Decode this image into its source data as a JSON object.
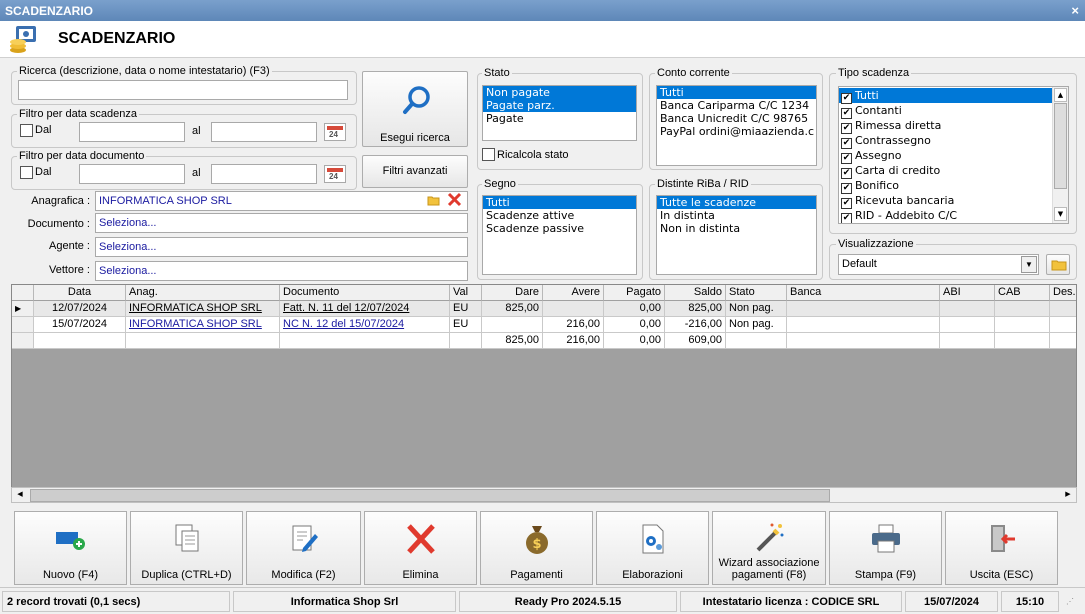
{
  "window": {
    "title": "SCADENZARIO",
    "close": "×"
  },
  "header": {
    "title": "SCADENZARIO"
  },
  "search": {
    "ricerca_label": "Ricerca (descrizione, data o nome intestatario) (F3)",
    "ricerca_value": "",
    "filtro_scadenza_label": "Filtro per data scadenza",
    "filtro_documento_label": "Filtro per data documento",
    "dal_label": "Dal",
    "al_label": "al",
    "cal_text": "24",
    "esegui_label": "Esegui ricerca",
    "filtri_avanzati_label": "Filtri avanzati"
  },
  "anagrafica": {
    "anagrafica_label": "Anagrafica :",
    "anagrafica_value": "INFORMATICA SHOP SRL",
    "documento_label": "Documento :",
    "documento_value": "Seleziona...",
    "agente_label": "Agente :",
    "agente_value": "Seleziona...",
    "vettore_label": "Vettore :",
    "vettore_value": "Seleziona..."
  },
  "stato": {
    "label": "Stato",
    "items": [
      "Non pagate",
      "Pagate parz.",
      "Pagate"
    ],
    "ricalcola": "Ricalcola stato"
  },
  "conto": {
    "label": "Conto corrente",
    "items": [
      "Tutti",
      "Banca Cariparma C/C 1234",
      "Banca Unicredit C/C 98765",
      "PayPal ordini@miaazienda.c"
    ]
  },
  "segno": {
    "label": "Segno",
    "items": [
      "Tutti",
      "Scadenze attive",
      "Scadenze passive"
    ]
  },
  "distinte": {
    "label": "Distinte RiBa / RID",
    "items": [
      "Tutte le scadenze",
      "In distinta",
      "Non in distinta"
    ]
  },
  "tipo": {
    "label": "Tipo scadenza",
    "items": [
      "Tutti",
      "Contanti",
      "Rimessa diretta",
      "Contrassegno",
      "Assegno",
      "Carta di credito",
      "Bonifico",
      "Ricevuta bancaria",
      "RID - Addebito C/C"
    ]
  },
  "visualizzazione": {
    "label": "Visualizzazione",
    "value": "Default"
  },
  "grid": {
    "columns": [
      "Data",
      "Anag.",
      "Documento",
      "Val",
      "Dare",
      "Avere",
      "Pagato",
      "Saldo",
      "Stato",
      "Banca",
      "ABI",
      "CAB",
      "Des."
    ],
    "rows": [
      {
        "data": "12/07/2024",
        "anag": "INFORMATICA SHOP SRL",
        "documento": "Fatt. N. 11 del 12/07/2024",
        "val": "EU",
        "dare": "825,00",
        "avere": "",
        "pagato": "0,00",
        "saldo": "825,00",
        "stato": "Non pag."
      },
      {
        "data": "15/07/2024",
        "anag": "INFORMATICA SHOP SRL",
        "documento": "NC N. 12 del 15/07/2024",
        "val": "EU",
        "dare": "",
        "avere": "216,00",
        "pagato": "0,00",
        "saldo": "-216,00",
        "stato": "Non pag."
      }
    ],
    "totals": {
      "dare": "825,00",
      "avere": "216,00",
      "pagato": "0,00",
      "saldo": "609,00"
    }
  },
  "toolbar": {
    "nuovo": "Nuovo (F4)",
    "duplica": "Duplica (CTRL+D)",
    "modifica": "Modifica (F2)",
    "elimina": "Elimina",
    "pagamenti": "Pagamenti",
    "elaborazioni": "Elaborazioni",
    "wizard_1": "Wizard associazione",
    "wizard_2": "pagamenti (F8)",
    "stampa": "Stampa (F9)",
    "uscita": "Uscita (ESC)"
  },
  "status": {
    "records": "2 record trovati (0,1 secs)",
    "company": "Informatica Shop Srl",
    "version": "Ready Pro 2024.5.15",
    "license": "Intestatario licenza : CODICE SRL",
    "date": "15/07/2024",
    "time": "15:10"
  },
  "colors": {
    "selection": "#0078d7",
    "link": "#1a1aa0",
    "title_bar": "#6a90c0",
    "delete": "#e03a2e"
  }
}
